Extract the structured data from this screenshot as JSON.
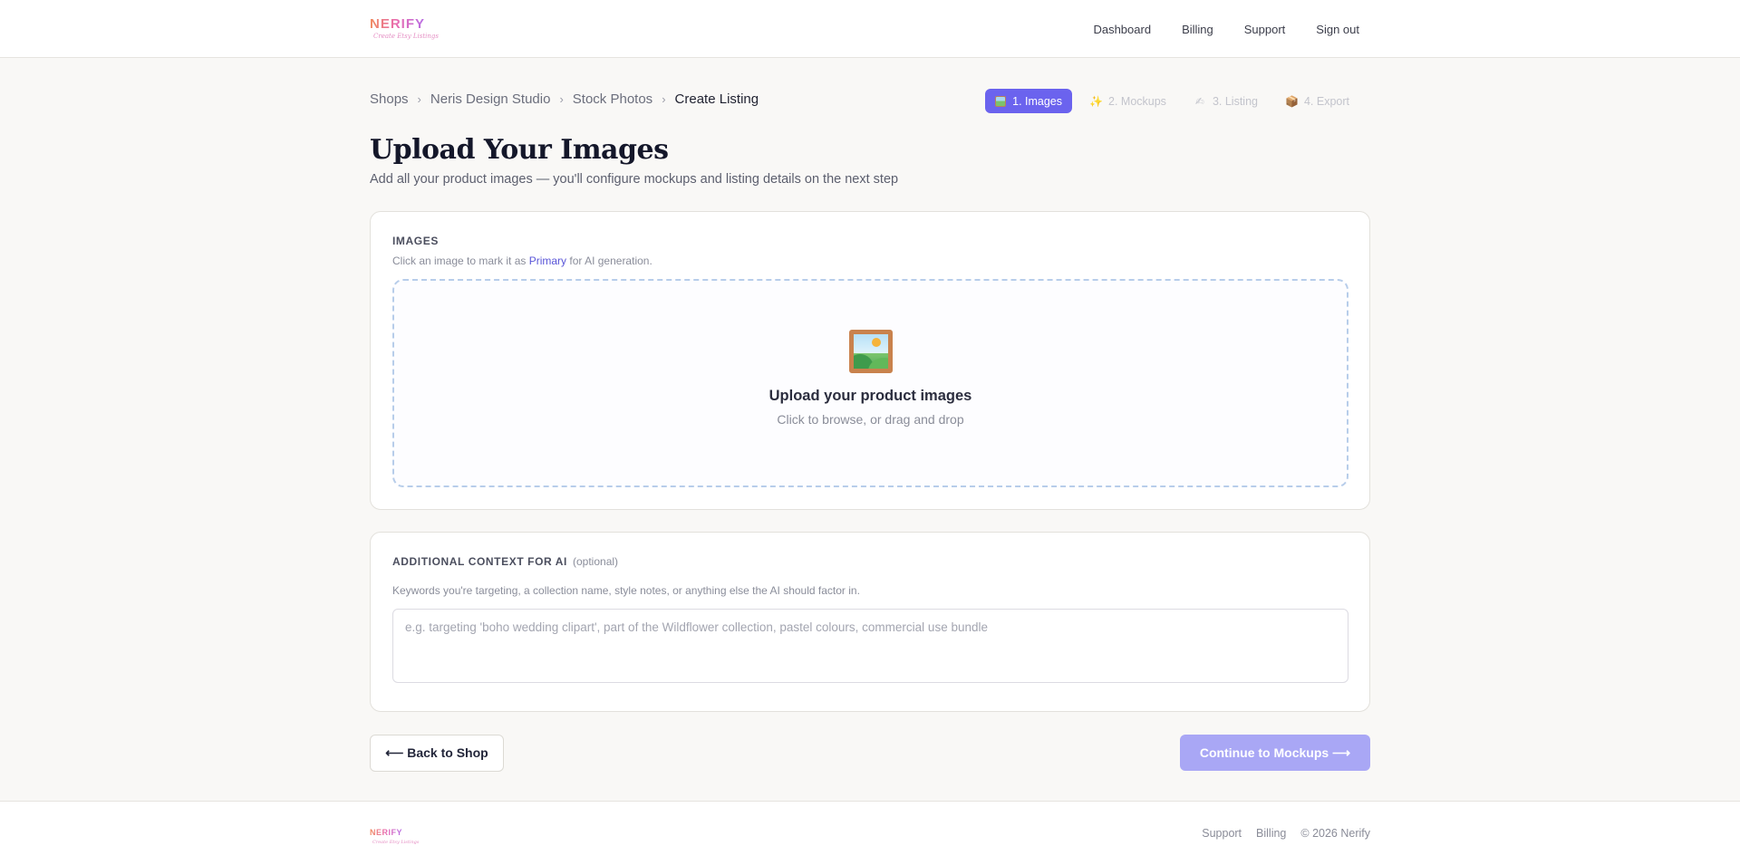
{
  "header": {
    "logo": {
      "word": "NERIFY",
      "tagline": "Create Etsy Listings"
    },
    "nav": [
      "Dashboard",
      "Billing",
      "Support",
      "Sign out"
    ]
  },
  "breadcrumb": {
    "items": [
      "Shops",
      "Neris Design Studio",
      "Stock Photos"
    ],
    "separator": "›",
    "current": "Create Listing"
  },
  "steps": [
    {
      "icon": "framed-picture-icon",
      "label": "1. Images",
      "active": true
    },
    {
      "icon": "sparkles-icon",
      "glyph": "✨",
      "label": "2. Mockups",
      "active": false
    },
    {
      "icon": "writing-hand-icon",
      "glyph": "✍",
      "label": "3. Listing",
      "active": false
    },
    {
      "icon": "package-icon",
      "glyph": "📦",
      "label": "4. Export",
      "active": false
    }
  ],
  "page": {
    "title": "Upload Your Images",
    "subtitle": "Add all your product images — you'll configure mockups and listing details on the next step"
  },
  "images_card": {
    "label": "IMAGES",
    "hint_before": "Click an image to mark it as ",
    "hint_link": "Primary",
    "hint_after": " for AI generation.",
    "dropzone": {
      "icon": "framed-picture-icon",
      "title": "Upload your product images",
      "subtitle": "Click to browse, or drag and drop"
    }
  },
  "context_card": {
    "label": "ADDITIONAL CONTEXT FOR AI",
    "optional": "(optional)",
    "hint": "Keywords you're targeting, a collection name, style notes, or anything else the AI should factor in.",
    "placeholder": "e.g. targeting 'boho wedding clipart', part of the Wildflower collection, pastel colours, commercial use bundle",
    "value": ""
  },
  "actions": {
    "back_label": "⟵ Back to Shop",
    "continue_label": "Continue to Mockups ⟶"
  },
  "footer": {
    "logo_word": "NERIFY",
    "logo_tagline": "Create Etsy Listings",
    "links": [
      "Support",
      "Billing"
    ],
    "copyright": "© 2026 Nerify"
  },
  "colors": {
    "accent": "#6b63ee",
    "accent_disabled": "#a9a7f5",
    "link": "#5a56d8",
    "background": "#f9f8f6"
  }
}
